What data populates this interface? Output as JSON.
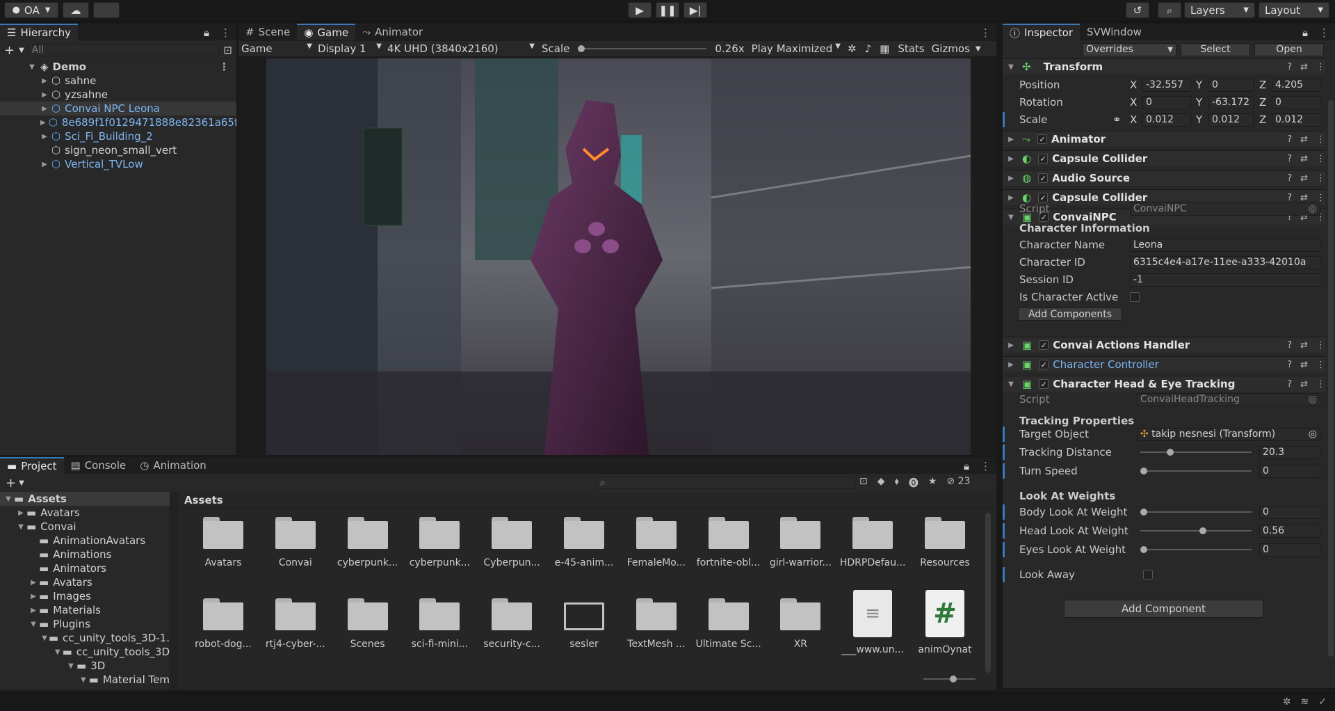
{
  "toolbar": {
    "account": "OA",
    "layers": "Layers",
    "layout": "Layout"
  },
  "hierarchy": {
    "tab": "Hierarchy",
    "search_placeholder": "All",
    "scene": "Demo",
    "items": [
      {
        "label": "sahne",
        "prefab": false
      },
      {
        "label": "yzsahne",
        "prefab": false
      },
      {
        "label": "Convai NPC Leona",
        "prefab": true
      },
      {
        "label": "8e689f1f0129471888e82361a65f",
        "prefab": true
      },
      {
        "label": "Sci_Fi_Building_2",
        "prefab": true
      },
      {
        "label": "sign_neon_small_vert",
        "prefab": false
      },
      {
        "label": "Vertical_TVLow",
        "prefab": true
      }
    ]
  },
  "game": {
    "tabs": [
      "Scene",
      "Game",
      "Animator"
    ],
    "display_mode": "Game",
    "display": "Display 1",
    "resolution": "4K UHD (3840x2160)",
    "scale_label": "Scale",
    "scale_value": "0.26x",
    "play_mode": "Play Maximized",
    "stats": "Stats",
    "gizmos": "Gizmos"
  },
  "project": {
    "tabs": [
      "Project",
      "Console",
      "Animation"
    ],
    "count": "23",
    "breadcrumb": "Assets",
    "tree": [
      {
        "label": "Assets",
        "depth": 0,
        "open": true,
        "bold": true
      },
      {
        "label": "Avatars",
        "depth": 1
      },
      {
        "label": "Convai",
        "depth": 1,
        "open": true
      },
      {
        "label": "AnimationAvatars",
        "depth": 2,
        "leaf": true
      },
      {
        "label": "Animations",
        "depth": 2,
        "leaf": true
      },
      {
        "label": "Animators",
        "depth": 2,
        "leaf": true
      },
      {
        "label": "Avatars",
        "depth": 2
      },
      {
        "label": "Images",
        "depth": 2
      },
      {
        "label": "Materials",
        "depth": 2
      },
      {
        "label": "Plugins",
        "depth": 2,
        "open": true
      },
      {
        "label": "cc_unity_tools_3D-1.",
        "depth": 3,
        "open": true
      },
      {
        "label": "cc_unity_tools_3D",
        "depth": 4,
        "open": true
      },
      {
        "label": "3D",
        "depth": 5,
        "open": true
      },
      {
        "label": "Material Tem",
        "depth": 6,
        "open": true
      }
    ],
    "assets": [
      {
        "label": "Avatars",
        "kind": "folder"
      },
      {
        "label": "Convai",
        "kind": "folder"
      },
      {
        "label": "cyberpunk...",
        "kind": "folder"
      },
      {
        "label": "cyberpunk...",
        "kind": "folder"
      },
      {
        "label": "Cyberpun...",
        "kind": "folder"
      },
      {
        "label": "e-45-anim...",
        "kind": "folder"
      },
      {
        "label": "FemaleMo...",
        "kind": "folder"
      },
      {
        "label": "fortnite-obl...",
        "kind": "folder"
      },
      {
        "label": "girl-warrior...",
        "kind": "folder"
      },
      {
        "label": "HDRPDefau...",
        "kind": "folder"
      },
      {
        "label": "Resources",
        "kind": "folder"
      },
      {
        "label": "robot-dog...",
        "kind": "folder"
      },
      {
        "label": "rtj4-cyber-...",
        "kind": "folder"
      },
      {
        "label": "Scenes",
        "kind": "folder"
      },
      {
        "label": "sci-fi-mini...",
        "kind": "folder"
      },
      {
        "label": "security-c...",
        "kind": "folder"
      },
      {
        "label": "sesler",
        "kind": "empty"
      },
      {
        "label": "TextMesh ...",
        "kind": "folder"
      },
      {
        "label": "Ultimate Sc...",
        "kind": "folder"
      },
      {
        "label": "XR",
        "kind": "folder"
      },
      {
        "label": "___www.un...",
        "kind": "doc"
      },
      {
        "label": "animOynat",
        "kind": "script"
      }
    ]
  },
  "inspector": {
    "tabs": [
      "Inspector",
      "SVWindow"
    ],
    "overrides": "Overrides",
    "select": "Select",
    "open": "Open",
    "transform": {
      "title": "Transform",
      "position": {
        "label": "Position",
        "x": "-32.557",
        "y": "0",
        "z": "4.205"
      },
      "rotation": {
        "label": "Rotation",
        "x": "0",
        "y": "-63.172",
        "z": "0"
      },
      "scale": {
        "label": "Scale",
        "x": "0.012",
        "y": "0.012",
        "z": "0.012"
      }
    },
    "components_a": [
      "Animator",
      "Capsule Collider",
      "Audio Source",
      "Capsule Collider"
    ],
    "convai_npc": {
      "title": "ConvaiNPC",
      "script_label": "Script",
      "script_value": "ConvaiNPC",
      "section": "Character Information",
      "char_name_label": "Character Name",
      "char_name": "Leona",
      "char_id_label": "Character ID",
      "char_id": "6315c4e4-a17e-11ee-a333-42010a",
      "session_label": "Session ID",
      "session": "-1",
      "active_label": "Is Character Active",
      "add_components": "Add Components"
    },
    "components_b": [
      {
        "label": "Convai Actions Handler",
        "blue": false
      },
      {
        "label": "Character Controller",
        "blue": true
      }
    ],
    "head_tracking": {
      "title": "Character Head & Eye Tracking",
      "script_label": "Script",
      "script_value": "ConvaiHeadTracking",
      "section": "Tracking Properties",
      "target_label": "Target Object",
      "target_value": "takip nesnesi (Transform)",
      "distance_label": "Tracking Distance",
      "distance": "20.3",
      "turn_label": "Turn Speed",
      "turn": "0",
      "weights_section": "Look At Weights",
      "body_label": "Body Look At Weight",
      "body": "0",
      "head_label": "Head Look At Weight",
      "head": "0.56",
      "eyes_label": "Eyes Look At Weight",
      "eyes": "0",
      "look_away_label": "Look Away"
    },
    "add_component": "Add Component"
  }
}
